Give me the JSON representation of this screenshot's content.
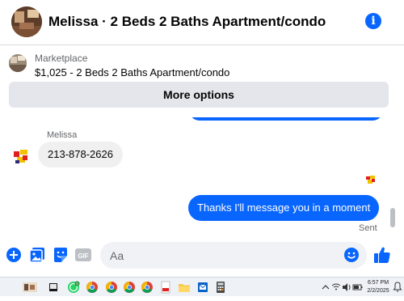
{
  "header": {
    "title": "Melissa · 2 Beds 2 Baths Apartment/condo",
    "accent": "#0866ff"
  },
  "listing": {
    "source": "Marketplace",
    "title": "$1,025 - 2 Beds 2 Baths Apartment/condo",
    "more_options_label": "More options"
  },
  "conversation": {
    "sender_name": "Melissa",
    "incoming_message": "213-878-2626",
    "outgoing_message": "Thanks I'll message you in a moment",
    "status": "Sent",
    "outgoing_color": "#0866ff",
    "incoming_color": "#f0f0f0"
  },
  "composer": {
    "placeholder": "Aa",
    "icons": [
      "plus-circle-icon",
      "photo-icon",
      "sticker-icon",
      "gif-icon",
      "emoji-icon",
      "thumbs-up-icon"
    ],
    "gif_label": "GIF"
  },
  "taskbar": {
    "apps": [
      "search-icon",
      "file-explorer-icon",
      "whatsapp-icon",
      "chrome-icon",
      "chrome-icon",
      "chrome-icon",
      "chrome-icon",
      "pdf-icon",
      "folder-icon",
      "outlook-icon",
      "calculator-icon"
    ],
    "whatsapp_badge": "5",
    "time": "6:57 PM",
    "date": "2/2/2025"
  }
}
